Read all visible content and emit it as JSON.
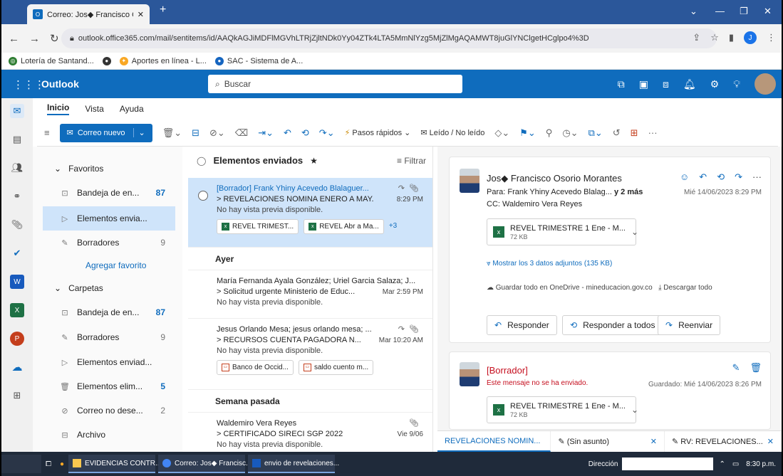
{
  "browser": {
    "tab_title": "Correo: Jos◆ Francisco Osorio M",
    "url": "outlook.office365.com/mail/sentitems/id/AAQkAGJiMDFlMGVhLTRjZjltNDk0Yy04ZTk4LTA5MmNlYzg5MjZlMgAQAMWT8juGlYNClgetHCglpo4%3D",
    "bookmarks": [
      "Lotería de Santand...",
      "Aportes en línea - L...",
      "SAC - Sistema de A..."
    ]
  },
  "outlook": {
    "app_name": "Outlook",
    "search_placeholder": "Buscar",
    "ribbon_tabs": [
      "Inicio",
      "Vista",
      "Ayuda"
    ],
    "new_mail": "Correo nuevo",
    "quick_steps": "Pasos rápidos",
    "read_unread": "Leído / No leído"
  },
  "folders": {
    "favorites_header": "Favoritos",
    "folders_header": "Carpetas",
    "add_favorite": "Agregar favorito",
    "fav_items": [
      {
        "label": "Bandeja de en...",
        "count": "87"
      },
      {
        "label": "Elementos envia...",
        "count": ""
      },
      {
        "label": "Borradores",
        "count": "9"
      }
    ],
    "folder_items": [
      {
        "label": "Bandeja de en...",
        "count": "87"
      },
      {
        "label": "Borradores",
        "count": "9"
      },
      {
        "label": "Elementos enviad...",
        "count": ""
      },
      {
        "label": "Elementos elim...",
        "count": "5"
      },
      {
        "label": "Correo no dese...",
        "count": "2"
      },
      {
        "label": "Archivo",
        "count": ""
      }
    ]
  },
  "list": {
    "title": "Elementos enviados",
    "filter": "Filtrar",
    "group_yesterday": "Ayer",
    "group_last_week": "Semana pasada",
    "no_preview": "No hay vista previa disponible.",
    "messages": [
      {
        "from": "[Borrador] Frank Yhiny Acevedo Blalaguer...",
        "subject": "> REVELACIONES NOMINA ENERO A MAY...",
        "time": "8:29 PM",
        "att1": "REVEL TRIMEST...",
        "att2": "REVEL Abr a Ma...",
        "more": "+3"
      },
      {
        "from": "María Fernanda Ayala González; Uriel Garcia Salaza; J...",
        "subject": "> Solicitud urgente Ministerio de Educ...",
        "time": "Mar 2:59 PM"
      },
      {
        "from": "Jesus Orlando Mesa; jesus orlando mesa; ...",
        "subject": "> RECURSOS CUENTA PAGADORA N...",
        "time": "Mar 10:20 AM",
        "att1": "Banco de Occid...",
        "att2": "saldo cuento m..."
      },
      {
        "from": "Waldemiro Vera Reyes",
        "subject": "> CERTIFICADO SIRECI SGP 2022",
        "time": "Vie 9/06"
      }
    ]
  },
  "reading": {
    "sender": "Jos◆ Francisco Osorio Morantes",
    "to_label": "Para: Frank Yhiny Acevedo Blalag...",
    "to_more": "y 2 más",
    "cc": "CC: Waldemiro Vera Reyes",
    "date": "Mié 14/06/2023 8:29 PM",
    "attachment_name": "REVEL TRIMESTRE 1 Ene - M...",
    "attachment_size": "72 KB",
    "show_attachments": "Mostrar los 3 datos adjuntos (135 KB)",
    "save_onedrive": "Guardar todo en OneDrive - mineducacion.gov.co",
    "download_all": "Descargar todo",
    "reply": "Responder",
    "reply_all": "Responder a todos",
    "forward": "Reenviar",
    "draft_title": "[Borrador]",
    "draft_sub": "Este mensaje no se ha enviado.",
    "draft_saved": "Guardado: Mié 14/06/2023 8:26 PM",
    "draft_attachment": "REVEL TRIMESTRE 1 Ene - M...",
    "draft_attachment_size": "72 KB",
    "bottom_tabs": [
      "REVELACIONES NOMIN...",
      "(Sin asunto)",
      "RV: REVELACIONES..."
    ]
  },
  "taskbar": {
    "apps": [
      "EVIDENCIAS CONTR...",
      "Correo: Jos◆ Francisc...",
      "envio de revelaciones..."
    ],
    "address_label": "Dirección",
    "time": "8:30 p.m."
  }
}
